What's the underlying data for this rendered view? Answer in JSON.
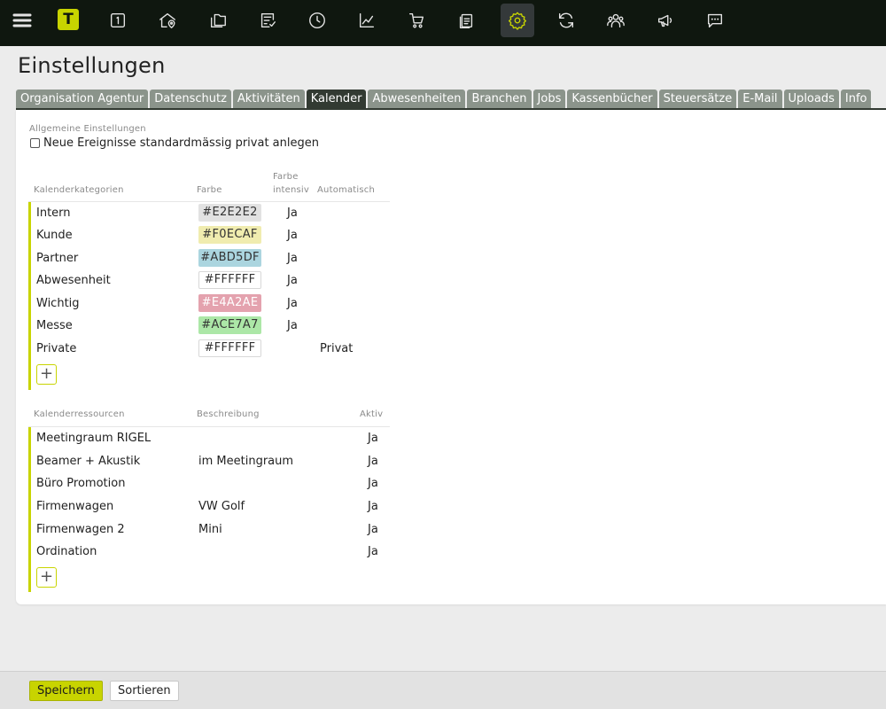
{
  "topbar": {
    "brand_letter": "T",
    "icons": [
      "menu-icon",
      "brand-logo",
      "calendar-day-icon",
      "home-location-icon",
      "folders-icon",
      "checklist-icon",
      "clock-icon",
      "chart-line-icon",
      "cart-icon",
      "documents-icon",
      "gear-icon",
      "refresh-icon",
      "users-icon",
      "megaphone-icon",
      "chat-icon"
    ],
    "active_icon": "gear-icon",
    "accent_color": "#c8d400"
  },
  "page": {
    "title": "Einstellungen"
  },
  "tabs": [
    {
      "label": "Organisation Agentur"
    },
    {
      "label": "Datenschutz"
    },
    {
      "label": "Aktivitäten"
    },
    {
      "label": "Kalender",
      "active": true
    },
    {
      "label": "Abwesenheiten"
    },
    {
      "label": "Branchen"
    },
    {
      "label": "Jobs"
    },
    {
      "label": "Kassenbücher"
    },
    {
      "label": "Steuersätze"
    },
    {
      "label": "E-Mail"
    },
    {
      "label": "Uploads"
    },
    {
      "label": "Info"
    }
  ],
  "general": {
    "section_label": "Allgemeine Einstellungen",
    "private_checkbox_label": "Neue Ereignisse standardmässig privat anlegen",
    "private_checked": false
  },
  "categories": {
    "headers": {
      "name": "Kalenderkategorien",
      "color": "Farbe",
      "intensive_line1": "Farbe",
      "intensive_line2": "intensiv",
      "automatic": "Automatisch"
    },
    "rows": [
      {
        "name": "Intern",
        "color": "#E2E2E2",
        "intensive": "Ja",
        "automatic": ""
      },
      {
        "name": "Kunde",
        "color": "#F0ECAF",
        "intensive": "Ja",
        "automatic": ""
      },
      {
        "name": "Partner",
        "color": "#ABD5DF",
        "intensive": "Ja",
        "automatic": ""
      },
      {
        "name": "Abwesenheit",
        "color": "#FFFFFF",
        "intensive": "Ja",
        "automatic": ""
      },
      {
        "name": "Wichtig",
        "color": "#E4A2AE",
        "intensive": "Ja",
        "automatic": ""
      },
      {
        "name": "Messe",
        "color": "#ACE7A7",
        "intensive": "Ja",
        "automatic": ""
      },
      {
        "name": "Private",
        "color": "#FFFFFF",
        "intensive": "",
        "automatic": "Privat"
      }
    ],
    "add_label": "+"
  },
  "resources": {
    "headers": {
      "name": "Kalenderressourcen",
      "description": "Beschreibung",
      "active": "Aktiv"
    },
    "rows": [
      {
        "name": "Meetingraum RIGEL",
        "description": "",
        "active": "Ja"
      },
      {
        "name": "Beamer + Akustik",
        "description": "im Meetingraum",
        "active": "Ja"
      },
      {
        "name": "Büro Promotion",
        "description": "",
        "active": "Ja"
      },
      {
        "name": "Firmenwagen",
        "description": "VW Golf",
        "active": "Ja"
      },
      {
        "name": "Firmenwagen 2",
        "description": "Mini",
        "active": "Ja"
      },
      {
        "name": "Ordination",
        "description": "",
        "active": "Ja"
      }
    ],
    "add_label": "+"
  },
  "footer": {
    "save_label": "Speichern",
    "sort_label": "Sortieren"
  }
}
